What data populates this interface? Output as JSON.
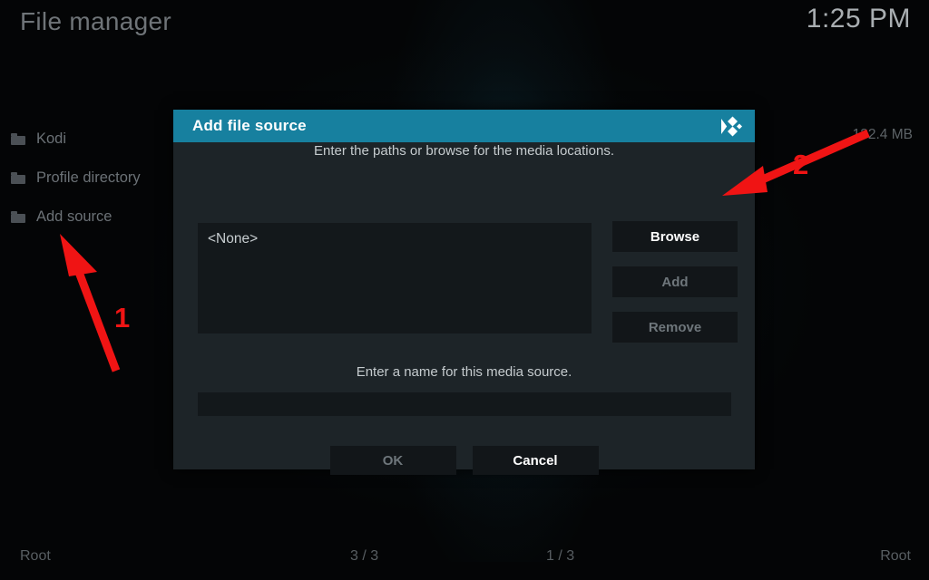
{
  "window": {
    "title": "File manager",
    "clock": "1:25 PM"
  },
  "colors": {
    "accent": "#17809f",
    "dialog_bg": "#1d2428",
    "field_bg": "#13181b",
    "annotation": "#f01414",
    "text_muted": "#6b7176",
    "text_bright": "#ffffff"
  },
  "file_list": {
    "items": [
      {
        "label": "Kodi",
        "icon": "folder-icon"
      },
      {
        "label": "Profile directory",
        "icon": "folder-icon"
      },
      {
        "label": "Add source",
        "icon": "folder-icon"
      }
    ]
  },
  "right_panel": {
    "size_label": "132.4 MB"
  },
  "dialog": {
    "title": "Add file source",
    "logo_icon": "kodi-logo-icon",
    "hint": "Enter the paths or browse for the media locations.",
    "paths": [
      "<None>"
    ],
    "side_buttons": [
      {
        "label": "Browse",
        "disabled": false
      },
      {
        "label": "Add",
        "disabled": true
      },
      {
        "label": "Remove",
        "disabled": true
      }
    ],
    "name_hint": "Enter a name for this media source.",
    "name_value": "",
    "footer_buttons": [
      {
        "label": "OK",
        "disabled": true
      },
      {
        "label": "Cancel",
        "disabled": false
      }
    ]
  },
  "bottom_bar": {
    "left": "Root",
    "counter_left": "3 / 3",
    "counter_right": "1 / 3",
    "right": "Root"
  },
  "annotations": [
    {
      "number": "1",
      "target": "add-source-item"
    },
    {
      "number": "2",
      "target": "browse-button"
    }
  ]
}
